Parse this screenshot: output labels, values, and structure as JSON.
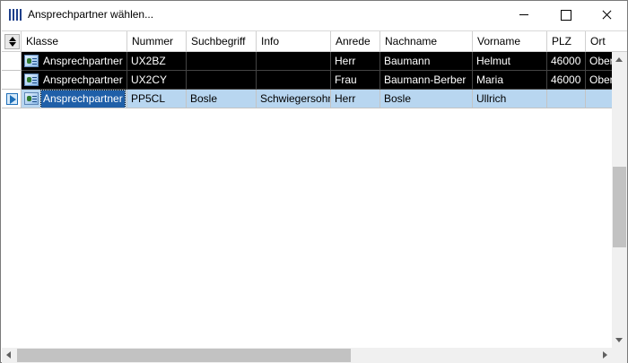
{
  "window": {
    "title": "Ansprechpartner wählen...",
    "icon": "app-icon",
    "controls": [
      "minimize-icon",
      "maximize-icon",
      "close-icon"
    ]
  },
  "grid": {
    "sort_icon": "sort-icon",
    "columns": [
      "Klasse",
      "Nummer",
      "Suchbegriff",
      "Info",
      "Anrede",
      "Nachname",
      "Vorname",
      "PLZ",
      "Ort"
    ],
    "rows": [
      {
        "klasse": "Ansprechpartner",
        "nummer": "UX2BZ",
        "suchbegriff": "",
        "info": "",
        "anrede": "Herr",
        "nachname": "Baumann",
        "vorname": "Helmut",
        "plz": "46000",
        "ort": "Ober"
      },
      {
        "klasse": "Ansprechpartner",
        "nummer": "UX2CY",
        "suchbegriff": "",
        "info": "",
        "anrede": "Frau",
        "nachname": "Baumann-Berber",
        "vorname": "Maria",
        "plz": "46000",
        "ort": "Ober"
      },
      {
        "klasse": "Ansprechpartner",
        "nummer": "PP5CL",
        "suchbegriff": "Bosle",
        "info": "Schwiegersohn",
        "anrede": "Herr",
        "nachname": "Bosle",
        "vorname": "Ullrich",
        "plz": "",
        "ort": ""
      }
    ],
    "row_styles": [
      "dark",
      "dark",
      "selected"
    ],
    "colors": {
      "dark_row_bg": "#000000",
      "selected_row_bg": "#b8d6f0",
      "selected_cell_bg": "#1f5fa8"
    }
  }
}
